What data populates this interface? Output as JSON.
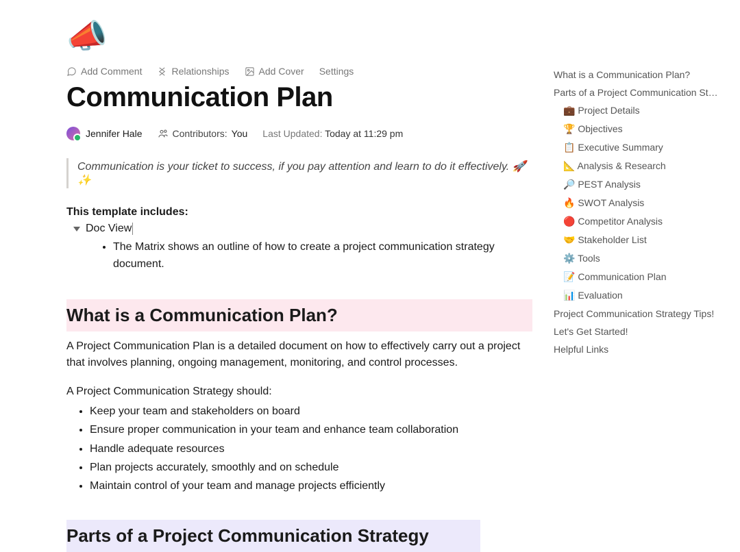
{
  "page": {
    "icon": "📣",
    "title": "Communication Plan"
  },
  "toolbar": {
    "add_comment": "Add Comment",
    "relationships": "Relationships",
    "add_cover": "Add Cover",
    "settings": "Settings"
  },
  "meta": {
    "author": "Jennifer Hale",
    "contributors_label": "Contributors:",
    "contributors_value": "You",
    "updated_label": "Last Updated:",
    "updated_value": "Today at 11:29 pm"
  },
  "quote": "Communication is your ticket to success, if you pay attention and learn to do it effectively. 🚀 ✨",
  "includes": {
    "heading": "This template includes:",
    "toggle_label": "Doc View",
    "bullet": "The Matrix shows an outline of how to create a project communication strategy document."
  },
  "section1": {
    "heading": "What is a Communication Plan?",
    "para": "A Project Communication Plan is a detailed document on how to effectively carry out a project that involves planning, ongoing management, monitoring, and control processes.",
    "should_intro": "A Project Communication Strategy should:",
    "should_items": [
      "Keep your team and stakeholders on board",
      "Ensure proper communication in your team and enhance team collaboration",
      "Handle adequate resources",
      "Plan projects accurately, smoothly and on schedule",
      "Maintain control of your team and manage projects efficiently"
    ]
  },
  "section2": {
    "heading": "Parts of a Project Communication Strategy"
  },
  "toc": [
    {
      "label": "What is a Communication Plan?",
      "level": 0
    },
    {
      "label": "Parts of a Project Communication Strategy",
      "level": 0
    },
    {
      "label": "💼 Project Details",
      "level": 1
    },
    {
      "label": "🏆 Objectives",
      "level": 1
    },
    {
      "label": "📋 Executive Summary",
      "level": 1
    },
    {
      "label": "📐 Analysis & Research",
      "level": 1
    },
    {
      "label": "🔎 PEST Analysis",
      "level": 1
    },
    {
      "label": "🔥 SWOT Analysis",
      "level": 1
    },
    {
      "label": "🔴 Competitor Analysis",
      "level": 1
    },
    {
      "label": "🤝 Stakeholder List",
      "level": 1
    },
    {
      "label": "⚙️ Tools",
      "level": 1
    },
    {
      "label": "📝 Communication Plan",
      "level": 1
    },
    {
      "label": "📊 Evaluation",
      "level": 1
    },
    {
      "label": "Project Communication Strategy Tips!",
      "level": 0
    },
    {
      "label": "Let's Get Started!",
      "level": 0
    },
    {
      "label": "Helpful Links",
      "level": 0
    }
  ]
}
